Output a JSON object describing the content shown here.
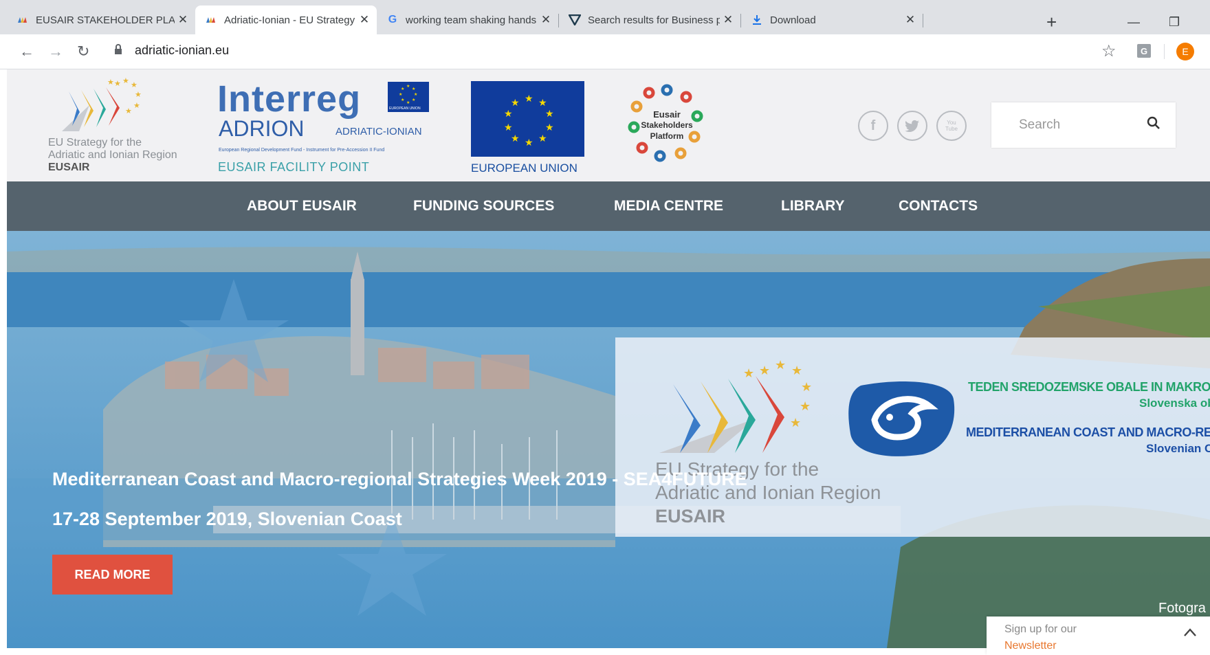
{
  "browser": {
    "tabs": [
      {
        "label": "EUSAIR STAKEHOLDER PLATFO",
        "icon": "eusair-favicon",
        "active": false
      },
      {
        "label": "Adriatic-Ionian - EU Strategy fo",
        "icon": "eusair-favicon",
        "active": true
      },
      {
        "label": "working team shaking hands -",
        "icon": "google-icon",
        "active": false
      },
      {
        "label": "Search results for Business peo",
        "icon": "vector-v-icon",
        "active": false
      },
      {
        "label": "Download",
        "icon": "download-icon",
        "active": false
      }
    ],
    "url": "adriatic-ionian.eu",
    "profile_initial": "E",
    "extension_letter": "G"
  },
  "header": {
    "eusair_logo_lines": [
      "EU Strategy for the",
      "Adriatic and Ionian Region",
      "EUSAIR"
    ],
    "interreg": {
      "title": "Interreg",
      "eu_flag_caption": "EUROPEAN UNION",
      "program": "ADRION",
      "program_sub": "ADRIATIC-IONIAN",
      "fund_line": "European Regional Development Fund - Instrument for Pre-Accession II Fund",
      "facility": "EUSAIR FACILITY POINT"
    },
    "eu_label": "EUROPEAN UNION",
    "stakeholders_logo": [
      "Eusair",
      "Stakeholders",
      "Platform"
    ],
    "social": [
      {
        "name": "facebook",
        "glyph": "f"
      },
      {
        "name": "twitter",
        "glyph": "t"
      },
      {
        "name": "youtube",
        "glyph": "You Tube"
      }
    ],
    "search_placeholder": "Search"
  },
  "nav": {
    "items": [
      "ABOUT EUSAIR",
      "FUNDING SOURCES",
      "MEDIA CENTRE",
      "LIBRARY",
      "CONTACTS"
    ]
  },
  "hero": {
    "title": "Mediterranean Coast and Macro-regional Strategies Week 2019 - SEA4FUTURE",
    "date": "17-28 September 2019, Slovenian Coast",
    "cta": "READ MORE",
    "banner": {
      "eusair_lines": [
        "EU Strategy for the",
        "Adriatic and Ionian Region",
        "EUSAIR"
      ],
      "slo_line1": "TEDEN SREDOZEMSKE OBALE IN MAKROR",
      "slo_line2": "Slovenska oba",
      "en_line1": "MEDITERRANEAN COAST AND MACRO-REGIO",
      "en_line2": "Slovenian Co"
    },
    "photo_credit": "Fotogra"
  },
  "newsletter": {
    "line1": "Sign up for our",
    "line2": "Newsletter"
  },
  "colors": {
    "nav_bg": "#55636d",
    "cta_bg": "#e0513f",
    "interreg_blue": "#3e6eb4",
    "eu_blue": "#103c9c",
    "banner_green": "#22a36a",
    "newsletter_orange": "#e8772e"
  }
}
